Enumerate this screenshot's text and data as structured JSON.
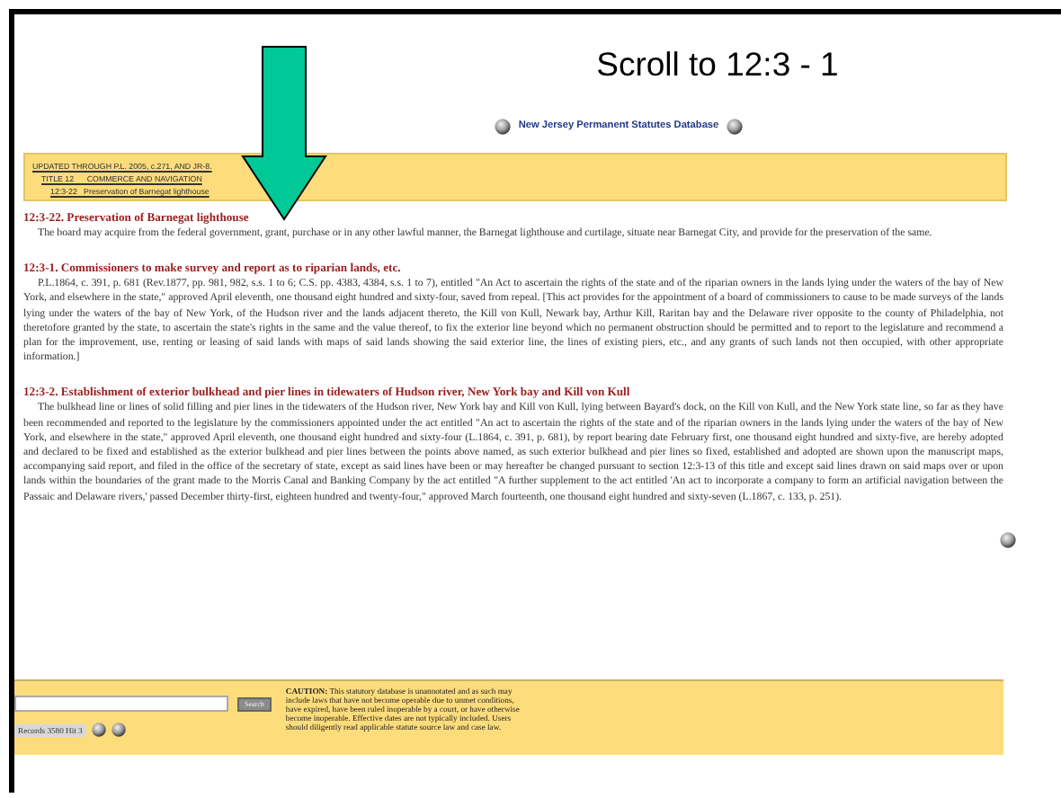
{
  "slide": {
    "title": "Scroll to 12:3 - 1"
  },
  "site": {
    "title": "New Jersey Permanent Statutes Database"
  },
  "breadcrumbs": [
    {
      "label": "UPDATED THROUGH P.L. 2005, c.271, AND JR-8."
    },
    {
      "label": "TITLE 12      COMMERCE AND NAVIGATION"
    },
    {
      "label": "12:3-22   Preservation of Barnegat lighthouse"
    }
  ],
  "sections": [
    {
      "heading": "12:3-22.  Preservation of Barnegat lighthouse",
      "body": "The board may acquire from the federal government, grant, purchase  or in any other lawful manner, the Barnegat lighthouse and curtilage, situate  near Barnegat City, and provide for the preservation of the same."
    },
    {
      "heading": "12:3-1.  Commissioners to make survey and report as to riparian lands, etc.",
      "body": "P.L.1864, c. 391, p. 681 (Rev.1877, pp. 981, 982, s.s. 1 to 6;  C.S. pp. 4383,  4384, s.s. 1 to 7), entitled  \"An Act to ascertain the rights of the state and of the riparian owners in the lands lying under the waters of the bay of New York,  and elsewhere in the state,\" approved April eleventh, one thousand eight  hundred and sixty-four, saved from repeal. [This act provides for the  appointment of a board of commissioners to cause to be made surveys of the  lands lying under the waters of the bay of New York, of the Hudson river and  the lands adjacent thereto, the Kill von Kull, Newark bay, Arthur Kill, Raritan  bay and the Delaware river opposite to the county of Philadelphia, not  theretofore granted by the state,  to ascertain the state's rights in the same  and the value thereof,  to fix the exterior line beyond which no permanent  obstruction should be permitted and to report to the legislature and recommend  a plan for the improvement, use, renting or leasing of said lands with maps of  said lands showing the said exterior line, the lines of existing piers, etc.,  and any grants of such lands not then occupied, with other appropriate information.]"
    },
    {
      "heading": "12:3-2.  Establishment of exterior bulkhead and pier lines in tidewaters of  Hudson river, New York bay and Kill von Kull",
      "body": "The bulkhead line or lines of solid filling and pier lines in the tidewaters  of the Hudson river, New York bay and Kill von Kull, lying between Bayard's  dock, on the Kill von Kull, and the New York state line, so far as they have  been recommended and reported to the legislature by the commissioners appointed  under the act entitled  \"An act to ascertain the rights of the state and of the  riparian owners in the lands lying under the waters of the bay of New York, and  elsewhere in the state,\" approved April eleventh, one thousand eight hundred  and sixty-four (L.1864, c. 391, p. 681), by report bearing date February first,  one thousand eight hundred and sixty-five, are hereby adopted and declared to be fixed and established as the exterior bulkhead and pier lines between the  points above named, as such exterior bulkhead and pier lines so fixed, established and adopted are shown upon the manuscript maps, accompanying said  report, and filed in the office of the secretary of state, except as said lines  have been or may hereafter be changed pursuant to section 12:3-13 of this title  and except said lines drawn on said maps over or upon lands within the  boundaries of the grant made to the Morris Canal and Banking Company by the act  entitled \"A further supplement to the act entitled 'An act to incorporate  a company to form an artificial navigation between the Passaic and Delaware  rivers,' passed December thirty-first, eighteen hundred and twenty-four,\"  approved March fourteenth, one thousand eight hundred and sixty-seven (L.1867,  c. 133, p. 251)."
    }
  ],
  "footer": {
    "search_button": "Search",
    "records": "Records 3580 Hit 3",
    "caution": "**CAUTION:** This statutory database is unannotated and as such may include laws that have not become operable due to unmet conditions, have expired, have been ruled inoperable by a court, or have otherwise become inoperable. Effective dates are not typically included. Users should diligently read applicable statute source law and case law."
  }
}
